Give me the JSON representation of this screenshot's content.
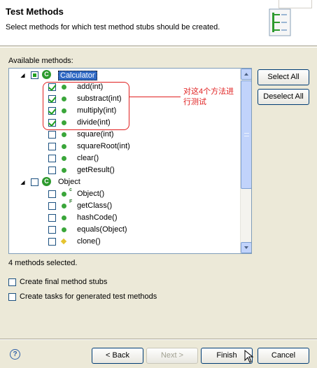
{
  "header": {
    "title": "Test Methods",
    "description": "Select methods for which test method stubs should be created."
  },
  "available_label": "Available methods:",
  "tree": {
    "classes": [
      {
        "name": "Calculator",
        "icon": "class-icon",
        "selected": true,
        "checked": "partial",
        "methods": [
          {
            "label": "add(int)",
            "checked": true,
            "icon": "public-method-icon"
          },
          {
            "label": "substract(int)",
            "checked": true,
            "icon": "public-method-icon"
          },
          {
            "label": "multiply(int)",
            "checked": true,
            "icon": "public-method-icon"
          },
          {
            "label": "divide(int)",
            "checked": true,
            "icon": "public-method-icon"
          },
          {
            "label": "square(int)",
            "checked": false,
            "icon": "public-method-icon"
          },
          {
            "label": "squareRoot(int)",
            "checked": false,
            "icon": "public-method-icon"
          },
          {
            "label": "clear()",
            "checked": false,
            "icon": "public-method-icon"
          },
          {
            "label": "getResult()",
            "checked": false,
            "icon": "public-method-icon"
          }
        ]
      },
      {
        "name": "Object",
        "icon": "class-icon",
        "selected": false,
        "checked": "unchecked",
        "methods": [
          {
            "label": "Object()",
            "checked": false,
            "icon": "constructor-icon",
            "badge": "c"
          },
          {
            "label": "getClass()",
            "checked": false,
            "icon": "final-method-icon",
            "badge": "F"
          },
          {
            "label": "hashCode()",
            "checked": false,
            "icon": "public-method-icon"
          },
          {
            "label": "equals(Object)",
            "checked": false,
            "icon": "public-method-icon"
          },
          {
            "label": "clone()",
            "checked": false,
            "icon": "protected-method-icon"
          }
        ]
      }
    ]
  },
  "annotation": {
    "text": "对这4个方法进行测试",
    "color": "#e02020"
  },
  "buttons": {
    "select_all": "Select All",
    "deselect_all": "Deselect All",
    "back": "< Back",
    "next": "Next >",
    "finish": "Finish",
    "cancel": "Cancel"
  },
  "status": "4 methods selected.",
  "options": [
    {
      "label": "Create final method stubs",
      "checked": false
    },
    {
      "label": "Create tasks for generated test methods",
      "checked": false
    }
  ]
}
